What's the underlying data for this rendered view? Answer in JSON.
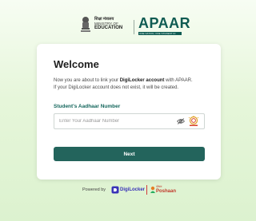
{
  "header": {
    "ministry_hindi": "शिक्षा मंत्रालय",
    "ministry_line1": "MINISTRY OF",
    "ministry_line2": "EDUCATION",
    "brand": "APAAR",
    "brand_sub": "ONE NATION, ONE STUDENT ID",
    "emblem_icon": "national-emblem-icon"
  },
  "card": {
    "title": "Welcome",
    "intro_prefix": "Now you are about to link your ",
    "intro_bold": "DigiLocker account",
    "intro_suffix": " with APAAR.",
    "intro_line2": "If your DigiLocker account does not exist, it will be created.",
    "field_label": "Student's Aadhaar Number",
    "input_placeholder": "Enter Your Aadhaar Number",
    "input_value": "",
    "visibility_icon": "eye-slash-icon",
    "aadhaar_icon": "aadhaar-logo-icon",
    "next_label": "Next"
  },
  "footer": {
    "powered_by": "Powered by",
    "digilocker": "DigiLocker",
    "poshan_hindi": "पोषण",
    "poshan": "Poshaan"
  },
  "colors": {
    "accent": "#23645c",
    "label": "#14665c",
    "brand": "#0f5b52",
    "background": "#e6f6da",
    "digilocker": "#3a33b8",
    "poshan": "#c0392b"
  }
}
